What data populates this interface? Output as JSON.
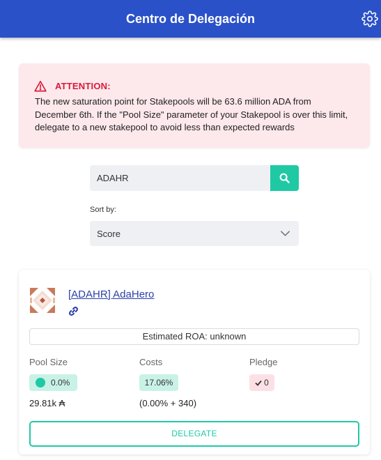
{
  "header": {
    "title": "Centro de Delegación",
    "settings_icon": "gear-icon"
  },
  "alert": {
    "title": "ATTENTION:",
    "text": "The new saturation point for Stakepools will be 63.6 million ADA from December 6th. If the \"Pool Size\" parameter of your Stakepool is over this limit, delegate to a new stakepool to avoid less than expected rewards",
    "icon": "warning-icon",
    "color": "#d81b3b"
  },
  "search": {
    "value": "ADAHR",
    "icon": "search-icon",
    "accent": "#1fc9a4"
  },
  "sort": {
    "label": "Sort by:",
    "selected": "Score"
  },
  "pool": {
    "name": "[ADAHR] AdaHero",
    "roa": "Estimated ROA: unknown",
    "pool_size_label": "Pool Size",
    "pool_size_pct": "0.0%",
    "pool_size_amount": "29.81k ₳",
    "costs_label": "Costs",
    "costs_pct": "17.06%",
    "costs_detail": "(0.00% + 340)",
    "pledge_label": "Pledge",
    "pledge_value": "0",
    "delegate_label": "DELEGATE"
  },
  "colors": {
    "brand": "#2a51c8",
    "accent": "#1fc9a4",
    "link": "#2a3fa8"
  }
}
